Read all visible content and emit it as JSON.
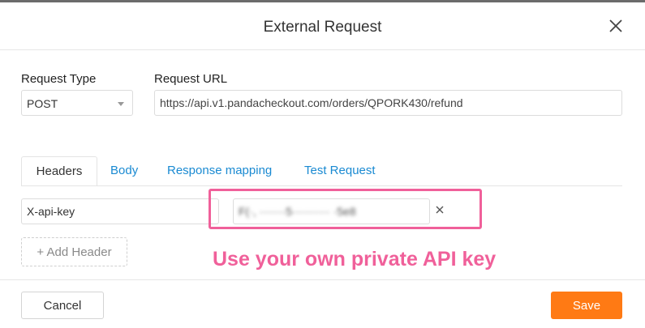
{
  "modal": {
    "title": "External Request",
    "close_icon": "close-icon"
  },
  "request": {
    "type_label": "Request Type",
    "type_value": "POST",
    "url_label": "Request URL",
    "url_value": "https://api.v1.pandacheckout.com/orders/QPORK430/refund"
  },
  "tabs": [
    {
      "label": "Headers",
      "active": true
    },
    {
      "label": "Body",
      "active": false
    },
    {
      "label": "Response mapping",
      "active": false
    },
    {
      "label": "Test Request",
      "active": false
    }
  ],
  "header_row": {
    "key": "X-api-key",
    "value_obscured": "F(·, ·······5·········· ·5e8"
  },
  "add_header_label": "+ Add Header",
  "annotation": {
    "text": "Use your own private API key",
    "color": "#f0609a"
  },
  "footer": {
    "cancel_label": "Cancel",
    "save_label": "Save"
  },
  "colors": {
    "accent": "#ff7a14",
    "link": "#1a8ad2"
  }
}
